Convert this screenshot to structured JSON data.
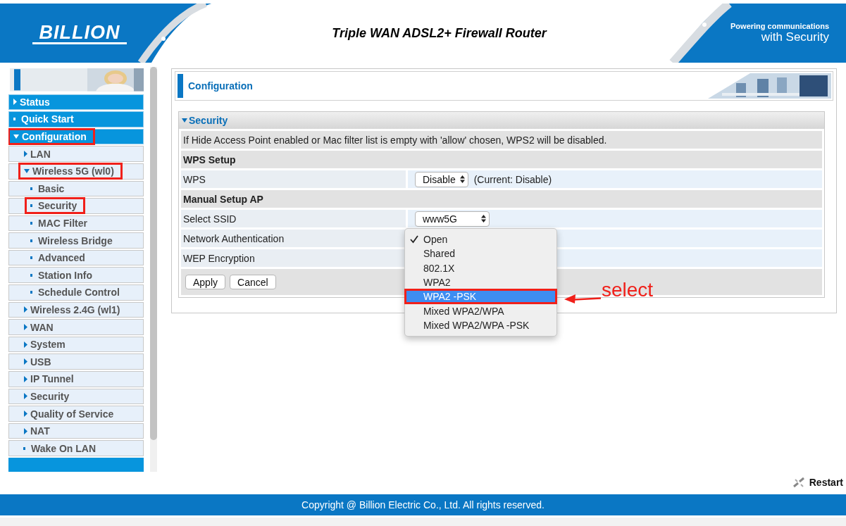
{
  "header": {
    "logo": "BILLION",
    "title": "Triple WAN ADSL2+ Firewall Router",
    "tagline": [
      "Powering communications",
      "with Security"
    ]
  },
  "sidebar": {
    "items": [
      {
        "label": "Status",
        "kind": "folder",
        "expanded": false,
        "marked": false
      },
      {
        "label": "Quick Start",
        "kind": "page",
        "marked": false
      },
      {
        "label": "Configuration",
        "kind": "folder",
        "expanded": true,
        "marked": true,
        "children": [
          {
            "label": "LAN",
            "kind": "folder",
            "expanded": false,
            "marked": false
          },
          {
            "label": "Wireless 5G (wl0)",
            "kind": "folder",
            "expanded": true,
            "marked": true,
            "children": [
              {
                "label": "Basic",
                "kind": "page",
                "marked": false
              },
              {
                "label": "Security",
                "kind": "page",
                "marked": true
              },
              {
                "label": "MAC Filter",
                "kind": "page",
                "marked": false
              },
              {
                "label": "Wireless Bridge",
                "kind": "page",
                "marked": false
              },
              {
                "label": "Advanced",
                "kind": "page",
                "marked": false
              },
              {
                "label": "Station Info",
                "kind": "page",
                "marked": false
              },
              {
                "label": "Schedule Control",
                "kind": "page",
                "marked": false
              }
            ]
          },
          {
            "label": "Wireless 2.4G (wl1)",
            "kind": "folder",
            "expanded": false,
            "marked": false
          },
          {
            "label": "WAN",
            "kind": "folder",
            "expanded": false,
            "marked": false
          },
          {
            "label": "System",
            "kind": "folder",
            "expanded": false,
            "marked": false
          },
          {
            "label": "USB",
            "kind": "folder",
            "expanded": false,
            "marked": false
          },
          {
            "label": "IP Tunnel",
            "kind": "folder",
            "expanded": false,
            "marked": false
          },
          {
            "label": "Security",
            "kind": "folder",
            "expanded": false,
            "marked": false
          },
          {
            "label": "Quality of Service",
            "kind": "folder",
            "expanded": false,
            "marked": false
          },
          {
            "label": "NAT",
            "kind": "folder",
            "expanded": false,
            "marked": false
          },
          {
            "label": "Wake On LAN",
            "kind": "page",
            "marked": false
          }
        ]
      }
    ]
  },
  "main": {
    "page_title": "Configuration",
    "section": {
      "title": "Security",
      "expanded": true,
      "rows": [
        {
          "kind": "note",
          "text": "If Hide Access Point enabled or Mac filter list is empty with 'allow' chosen, WPS2 will be disabled."
        },
        {
          "kind": "heading",
          "text": "WPS Setup"
        },
        {
          "kind": "select",
          "label": "WPS",
          "value": "Disable",
          "note": "(Current: Disable)"
        },
        {
          "kind": "heading",
          "text": "Manual Setup AP"
        },
        {
          "kind": "select",
          "label": "Select SSID",
          "value": "www5G"
        },
        {
          "kind": "menu",
          "label": "Network Authentication",
          "options": [
            {
              "label": "Open",
              "selected": true,
              "highlighted": false,
              "marked": false
            },
            {
              "label": "Shared",
              "selected": false,
              "highlighted": false,
              "marked": false
            },
            {
              "label": "802.1X",
              "selected": false,
              "highlighted": false,
              "marked": false
            },
            {
              "label": "WPA2",
              "selected": false,
              "highlighted": false,
              "marked": false
            },
            {
              "label": "WPA2 -PSK",
              "selected": false,
              "highlighted": true,
              "marked": true
            },
            {
              "label": "Mixed WPA2/WPA",
              "selected": false,
              "highlighted": false,
              "marked": false
            },
            {
              "label": "Mixed WPA2/WPA -PSK",
              "selected": false,
              "highlighted": false,
              "marked": false
            }
          ],
          "annotation": "select"
        },
        {
          "kind": "label",
          "label": "WEP Encryption"
        }
      ],
      "buttons": [
        "Apply",
        "Cancel"
      ]
    }
  },
  "restart": "Restart",
  "footer": "Copyright @ Billion Electric Co., Ltd. All rights reserved."
}
